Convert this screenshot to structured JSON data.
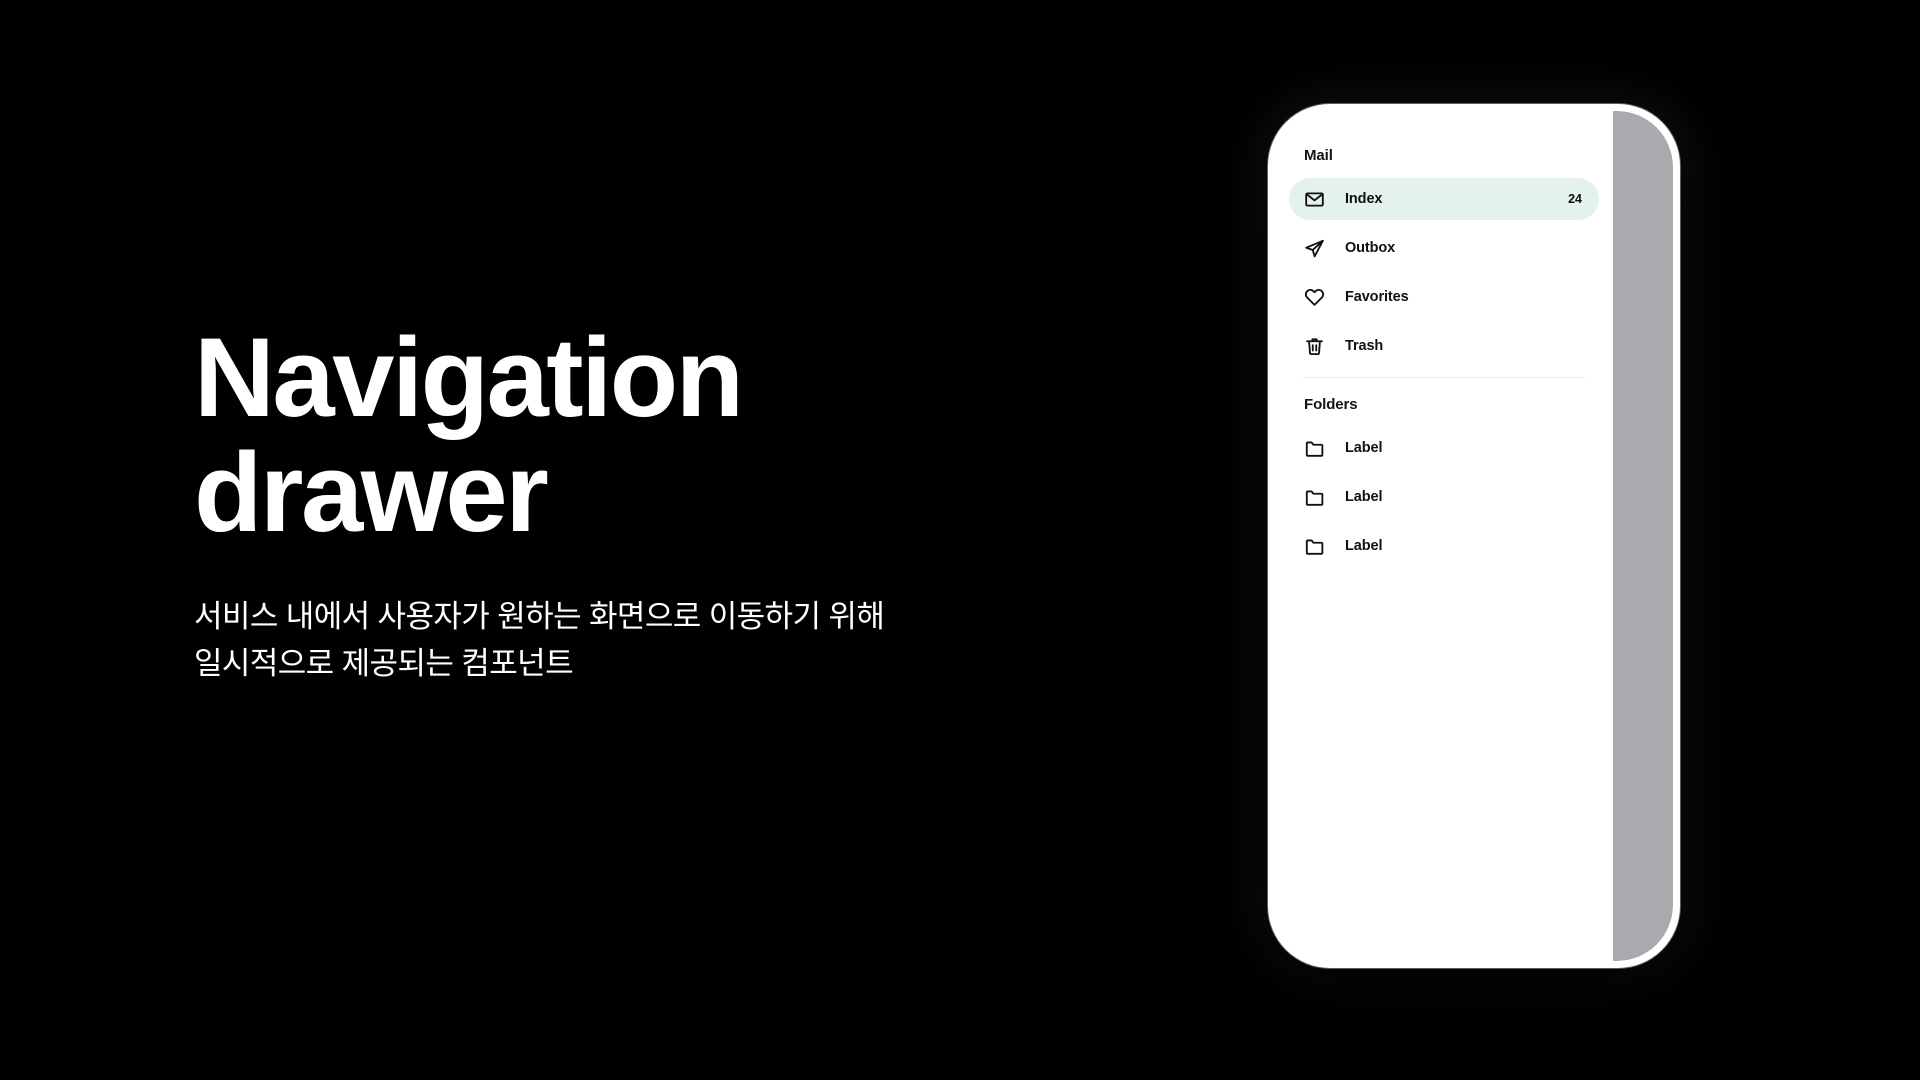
{
  "page": {
    "background_color": "#000000",
    "headline": "Navigation\ndrawer",
    "subcopy": "서비스 내에서 사용자가 원하는 화면으로 이동하기 위해\n일시적으로 제공되는 컴포넌트"
  },
  "colors": {
    "selected_item_bg": "#e4f2ef",
    "scrim": "#a8aaad",
    "drawer_bg": "#ffffff",
    "text": "#111111",
    "divider": "#ededed"
  },
  "drawer": {
    "sections": [
      {
        "title": "Mail",
        "items": [
          {
            "label": "Index",
            "icon": "envelope-icon",
            "badge": "24",
            "selected": true
          },
          {
            "label": "Outbox",
            "icon": "paper-plane-icon",
            "badge": "",
            "selected": false
          },
          {
            "label": "Favorites",
            "icon": "heart-icon",
            "badge": "",
            "selected": false
          },
          {
            "label": "Trash",
            "icon": "trash-icon",
            "badge": "",
            "selected": false
          }
        ]
      },
      {
        "title": "Folders",
        "items": [
          {
            "label": "Label",
            "icon": "folder-icon",
            "badge": "",
            "selected": false
          },
          {
            "label": "Label",
            "icon": "folder-icon",
            "badge": "",
            "selected": false
          },
          {
            "label": "Label",
            "icon": "folder-icon",
            "badge": "",
            "selected": false
          }
        ]
      }
    ]
  }
}
